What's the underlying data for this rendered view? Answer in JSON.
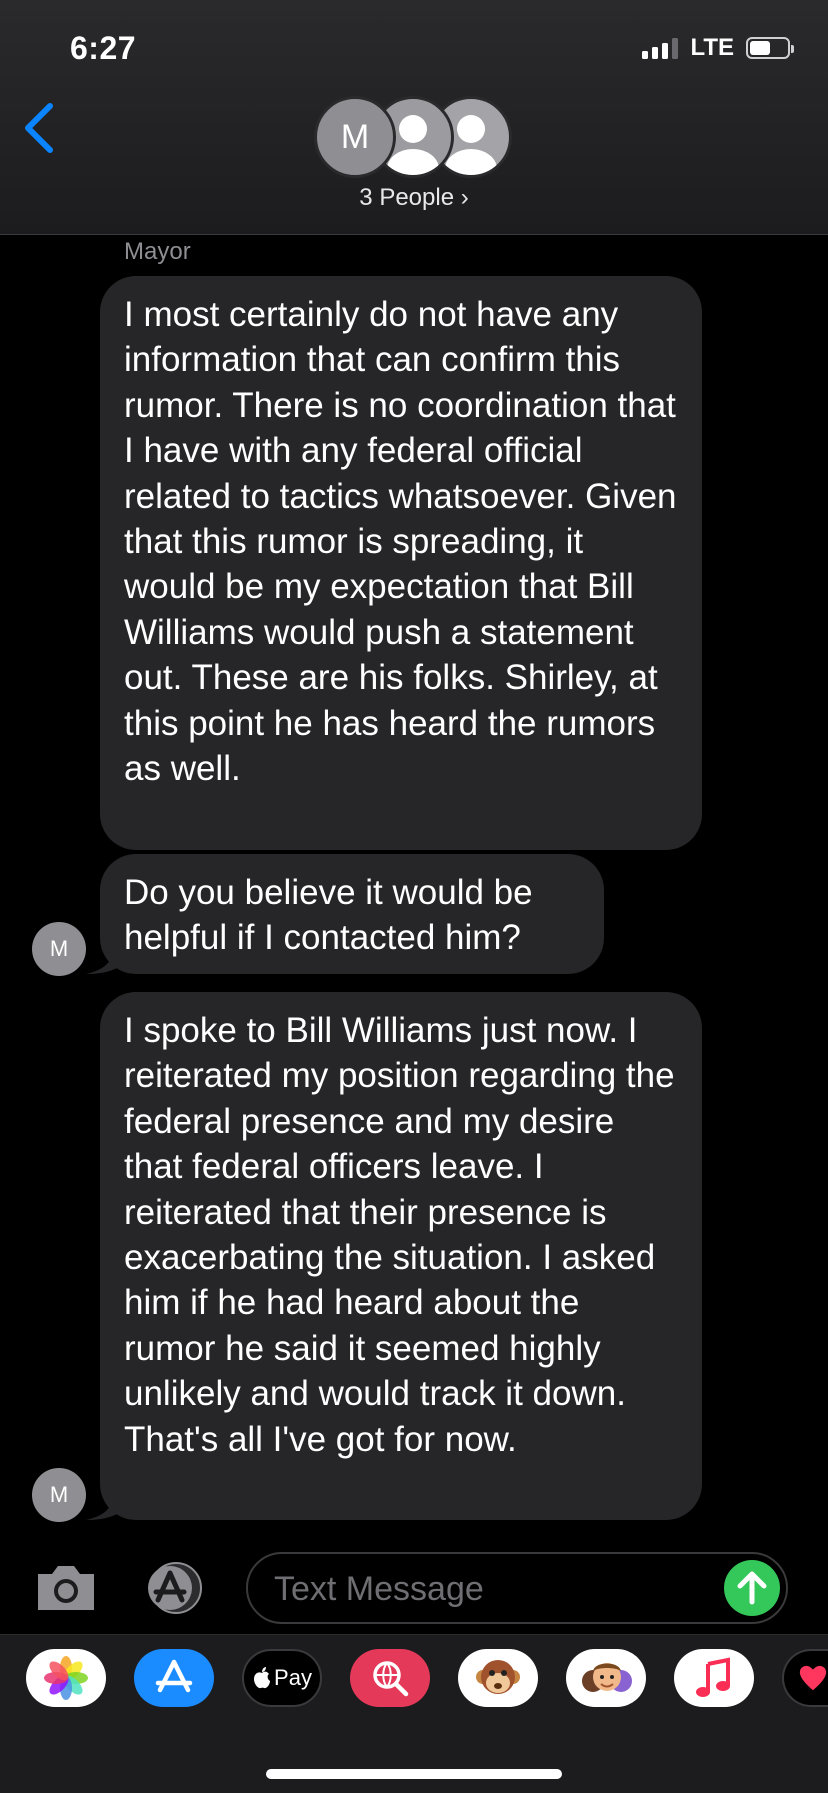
{
  "status": {
    "time": "6:27",
    "network": "LTE",
    "signal_bars": 4,
    "signal_active": 3,
    "battery_level": 0.55
  },
  "header": {
    "avatar_initial": "M",
    "people_label": "3 People ›"
  },
  "conversation": {
    "sender_name": "Mayor",
    "messages": [
      {
        "text": "I most certainly do not have any information that can confirm this rumor. There is no coordination that I have with any federal official related to tactics whatsoever. Given that this rumor is spreading, it would be my expectation that Bill Williams would push a statement out. These are his folks. Shirley, at this point he has heard the rumors as well."
      },
      {
        "text": "Do you believe it would be helpful if I contacted him?",
        "avatar_initial": "M"
      },
      {
        "text": "I spoke to Bill Williams  just now. I reiterated my position regarding the federal presence and my desire that federal officers  leave. I reiterated that their presence is exacerbating the situation. I asked him if he had heard about the rumor he said it seemed highly unlikely and would track it down. That's all I've got for now.",
        "avatar_initial": "M"
      }
    ]
  },
  "composer": {
    "placeholder": "Text Message"
  },
  "app_drawer": {
    "apps": [
      {
        "name": "photos-icon"
      },
      {
        "name": "app-store-icon"
      },
      {
        "name": "apple-pay-icon",
        "label": "Pay"
      },
      {
        "name": "web-search-icon"
      },
      {
        "name": "animoji-icon"
      },
      {
        "name": "memoji-icon"
      },
      {
        "name": "music-icon"
      },
      {
        "name": "digital-touch-icon"
      }
    ]
  },
  "colors": {
    "accent": "#0a84ff",
    "send": "#34c759",
    "bubble": "#262628",
    "background": "#000000"
  }
}
